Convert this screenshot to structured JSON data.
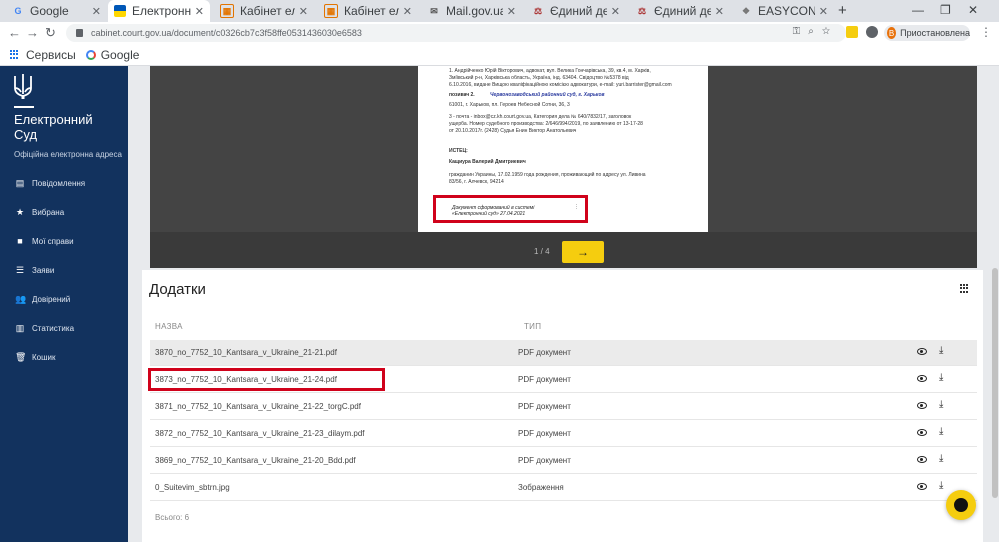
{
  "browser": {
    "tabs": [
      {
        "label": "Google",
        "favicon": "google-g-icon",
        "active": false
      },
      {
        "label": "Електронн",
        "favicon": "ukraine-flag-icon",
        "active": true
      },
      {
        "label": "Кабінет ел",
        "favicon": "cabinet-icon",
        "active": false
      },
      {
        "label": "Кабінет ел",
        "favicon": "cabinet-icon",
        "active": false
      },
      {
        "label": "Mail.gov.ua",
        "favicon": "mail-icon",
        "active": false
      },
      {
        "label": "Єдиний де",
        "favicon": "gavel-icon",
        "active": false
      },
      {
        "label": "Єдиний де",
        "favicon": "gavel-icon",
        "active": false
      },
      {
        "label": "EASYCON",
        "favicon": "easycon-icon",
        "active": false
      }
    ],
    "url": "cabinet.court.gov.ua/document/c0326cb7c3f58ffe0531436030e6583",
    "profile": {
      "initial": "В",
      "label": "Приостановлена"
    },
    "bookmarks": [
      {
        "label": "Сервисы",
        "icon": "apps-grid-icon"
      },
      {
        "label": "Google",
        "icon": "google-g-icon"
      }
    ]
  },
  "sidebar": {
    "title": "Електронний Суд",
    "subtitle": "Офіційна електронна адреса",
    "items": [
      {
        "label": "Повідомлення",
        "icon": "message-icon"
      },
      {
        "label": "Вибрана",
        "icon": "star-icon"
      },
      {
        "label": "Мої справи",
        "icon": "folder-icon"
      },
      {
        "label": "Заяви",
        "icon": "list-icon"
      },
      {
        "label": "Довірений",
        "icon": "people-icon"
      },
      {
        "label": "Статистика",
        "icon": "chart-icon"
      },
      {
        "label": "Кошик",
        "icon": "trash-icon"
      }
    ]
  },
  "document": {
    "lines": [
      "1. Андрійченко Юрій Вікторович, адвокат, вул. Велика Гончарівська, 39, кв.4, м. Харків,",
      "Зміївський р-н, Харківська область, Україна, інд. 63404. Свідоцтво №5378 від",
      "6.10.2016, видане Вищою кваліфікаційною комісією адвокатури, e-mail: yuri.barrister@gmail.com",
      "позивач 2.",
      "Червонозаводський районний суд, г. Харьков",
      "61001, г. Харьков, пл. Героев Небесной Сотни, 36, 3",
      "3 - почта - inbox@cz.kh.court.gov.ua, Категория дела № 640/7832/17, заголовок",
      "ущерба. Номер судебного производства: 2/646/994/2019, по заявлению от 13-17-28",
      "от 20.10.2017г. (2428) Судья Енин Виктор Анатольевич",
      "ИСТЕЦ:",
      "Кащиура Валерий Дмитриевич",
      "гражданин Украины, 17.02.1959 года рождения, проживающий по адресу ул. Ливина",
      "83/56, г. Алчевск, 94214"
    ],
    "stamp_line1": "Документ сформований в системі",
    "stamp_line2": "«Електронний суд» 27.04.2021",
    "pager": "1 / 4"
  },
  "attachments": {
    "title": "Додатки",
    "columns": {
      "name": "НАЗВА",
      "type": "ТИП"
    },
    "rows": [
      {
        "name": "3870_no_7752_10_Kantsara_v_Ukraine_21-21.pdf",
        "type": "PDF документ"
      },
      {
        "name": "3873_no_7752_10_Kantsara_v_Ukraine_21-24.pdf",
        "type": "PDF документ"
      },
      {
        "name": "3871_no_7752_10_Kantsara_v_Ukraine_21-22_torgC.pdf",
        "type": "PDF документ"
      },
      {
        "name": "3872_no_7752_10_Kantsara_v_Ukraine_21-23_dilaym.pdf",
        "type": "PDF документ"
      },
      {
        "name": "3869_no_7752_10_Kantsara_v_Ukraine_21-20_Bdd.pdf",
        "type": "PDF документ"
      },
      {
        "name": "0_Suitevim_sbtrn.jpg",
        "type": "Зображення"
      }
    ],
    "count": "Всього: 6"
  },
  "colors": {
    "sidebar": "#12325e",
    "accent": "#f5cd0f",
    "highlight": "#d0021b"
  }
}
